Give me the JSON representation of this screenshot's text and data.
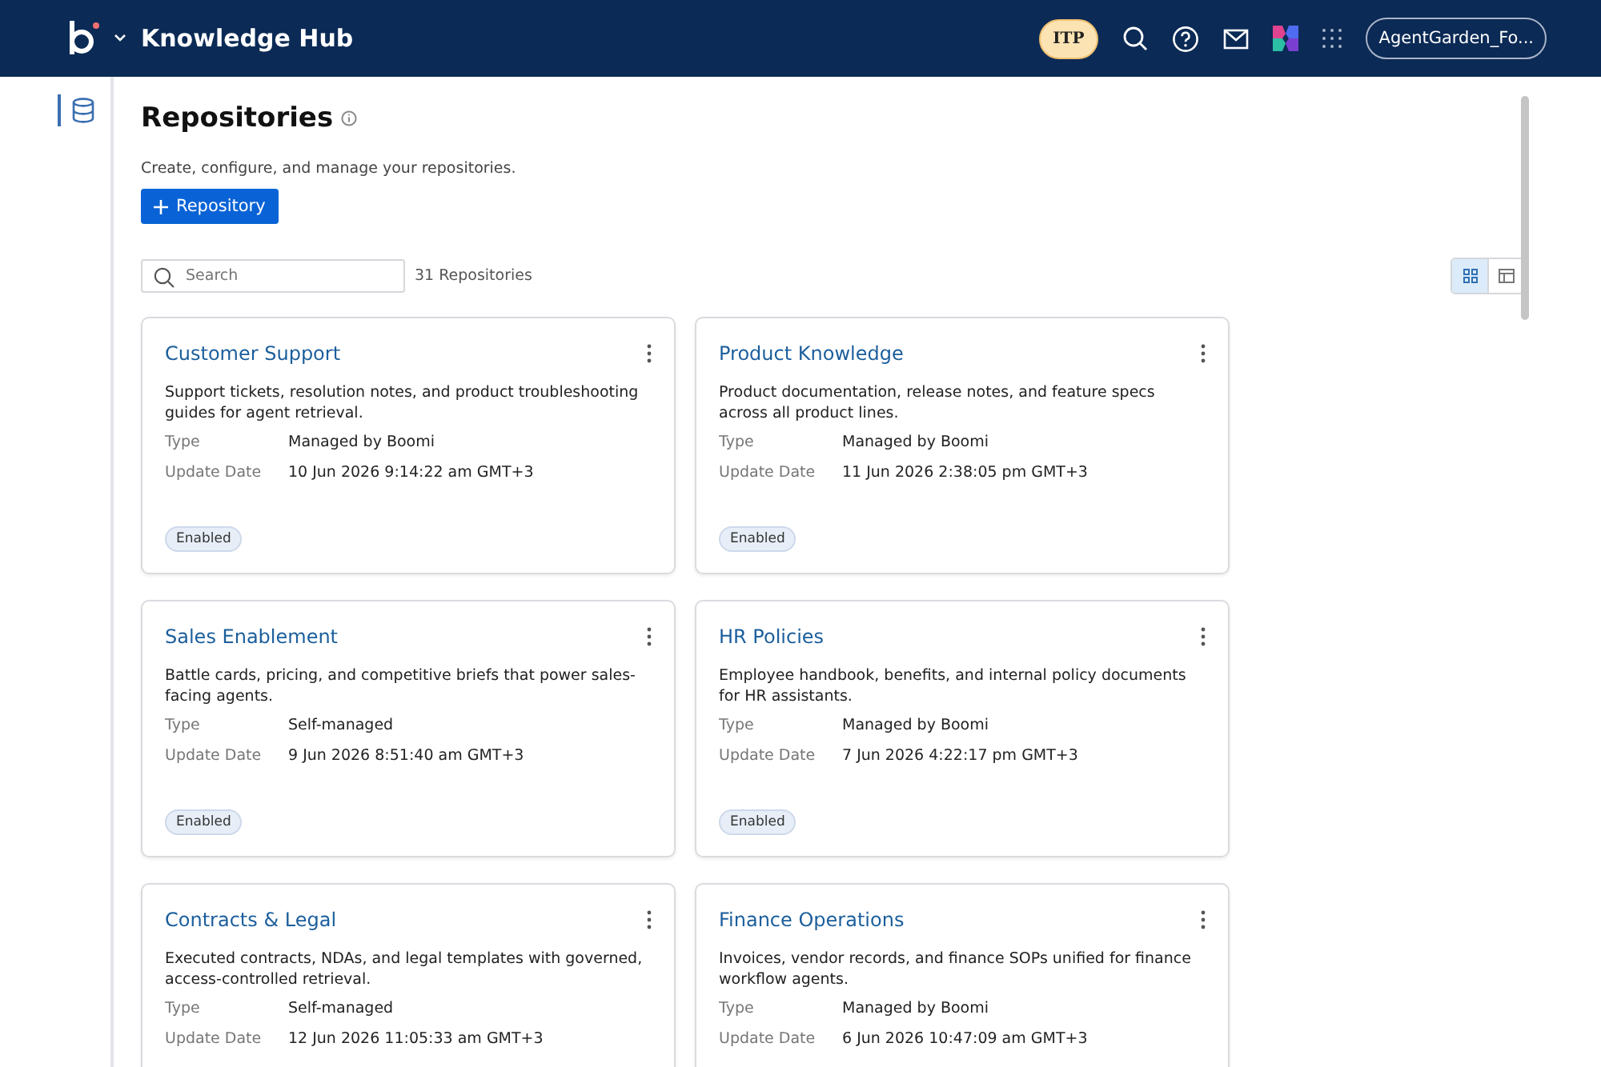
{
  "header": {
    "app_title": "Knowledge Hub",
    "env_badge": "ITP",
    "account": "AgentGarden_Fo..."
  },
  "sidebar": {
    "items": [
      {
        "kind": "database",
        "selected": true
      }
    ]
  },
  "page": {
    "title": "Repositories",
    "subtitle": "Create, configure, and manage your repositories.",
    "add_button": "Repository",
    "search": {
      "placeholder": "Search"
    },
    "count": "31 Repositories",
    "views": [
      {
        "kind": "grid",
        "selected": true
      },
      {
        "kind": "table",
        "selected": false
      }
    ]
  },
  "repositories": [
    {
      "name": "Customer Support",
      "description": "Support tickets, resolution notes, and product troubleshooting guides for agent retrieval.",
      "type_label": "Type",
      "type": "Managed by Boomi",
      "date_label": "Update Date",
      "date": "10 Jun 2026 9:14:22 am GMT+3",
      "status": "Enabled"
    },
    {
      "name": "Product Knowledge",
      "description": "Product documentation, release notes, and feature specs across all product lines.",
      "type_label": "Type",
      "type": "Managed by Boomi",
      "date_label": "Update Date",
      "date": "11 Jun 2026 2:38:05 pm GMT+3",
      "status": "Enabled"
    },
    {
      "name": "Sales Enablement",
      "description": "Battle cards, pricing, and competitive briefs that power sales-facing agents.",
      "type_label": "Type",
      "type": "Self-managed",
      "date_label": "Update Date",
      "date": "9 Jun 2026 8:51:40 am GMT+3",
      "status": "Enabled"
    },
    {
      "name": "HR Policies",
      "description": "Employee handbook, benefits, and internal policy documents for HR assistants.",
      "type_label": "Type",
      "type": "Managed by Boomi",
      "date_label": "Update Date",
      "date": "7 Jun 2026 4:22:17 pm GMT+3",
      "status": "Enabled"
    },
    {
      "name": "Contracts & Legal",
      "description": "Executed contracts, NDAs, and legal templates with governed, access-controlled retrieval.",
      "type_label": "Type",
      "type": "Self-managed",
      "date_label": "Update Date",
      "date": "12 Jun 2026 11:05:33 am GMT+3"
    },
    {
      "name": "Finance Operations",
      "description": "Invoices, vendor records, and finance SOPs unified for finance workflow agents.",
      "type_label": "Type",
      "type": "Managed by Boomi",
      "date_label": "Update Date",
      "date": "6 Jun 2026 10:47:09 am GMT+3"
    }
  ]
}
